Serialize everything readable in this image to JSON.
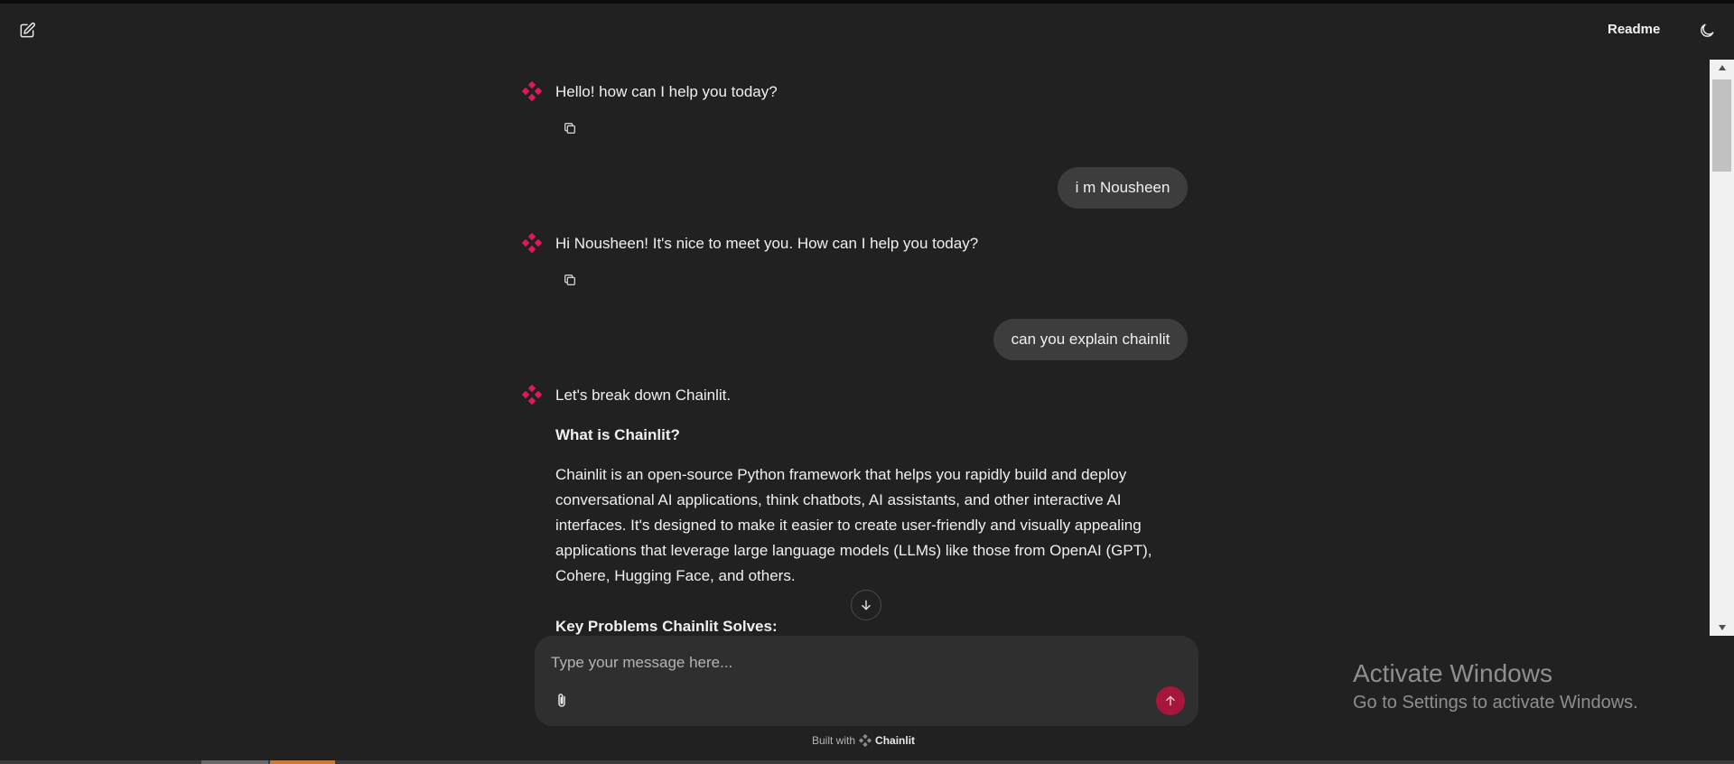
{
  "header": {
    "new_chat_icon": "edit-icon",
    "readme_label": "Readme",
    "theme_icon": "moon-icon"
  },
  "messages": [
    {
      "role": "assistant",
      "text": "Hello! how can I help you today?"
    },
    {
      "role": "user",
      "text": "i m Nousheen"
    },
    {
      "role": "assistant",
      "text": "Hi Nousheen! It's nice to meet you. How can I help you today?"
    },
    {
      "role": "user",
      "text": "can you explain chainlit"
    },
    {
      "role": "assistant",
      "intro": "Let's break down Chainlit.",
      "heading1": "What is Chainlit?",
      "body_lines": [
        "Chainlit is an open-source Python framework that helps you rapidly build and deploy",
        "conversational AI applications, think chatbots, AI assistants, and other interactive AI",
        "interfaces.  It's designed to make it easier to create user-friendly and visually appealing",
        "applications that leverage large language models (LLMs) like those from OpenAI (GPT),",
        "Cohere, Hugging Face, and others."
      ],
      "heading2": "Key Problems Chainlit Solves:"
    }
  ],
  "composer": {
    "placeholder": "Type your message here...",
    "value": ""
  },
  "footer": {
    "built_with": "Built with",
    "brand": "Chainlit"
  },
  "watermark": {
    "title": "Activate Windows",
    "subtitle": "Go to Settings to activate Windows."
  },
  "colors": {
    "background": "#212121",
    "accent": "#e0195a",
    "send_button": "#a5163a",
    "bubble": "#3d3d3d"
  }
}
